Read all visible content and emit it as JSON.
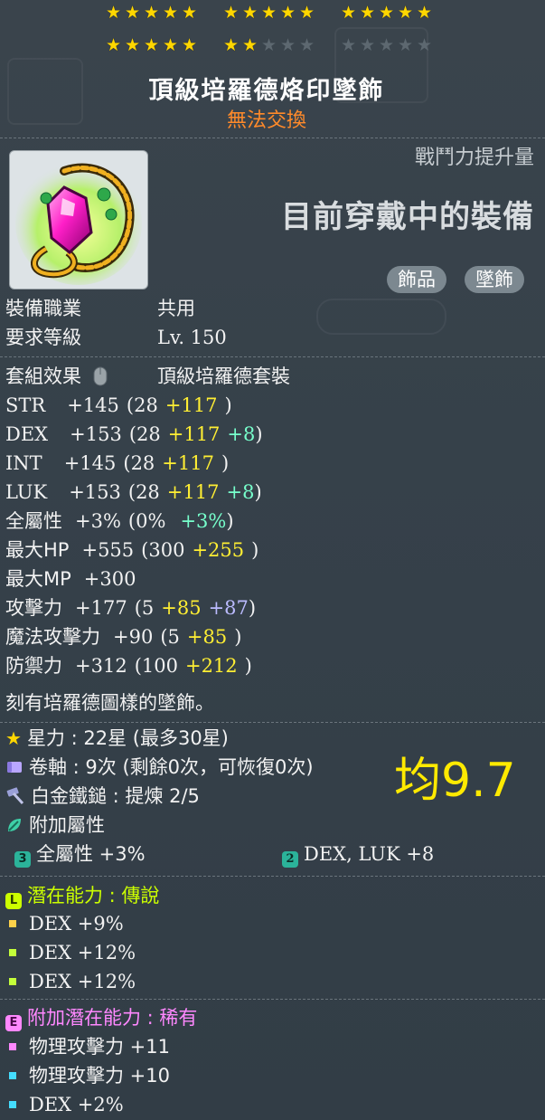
{
  "stars": {
    "filled": 22,
    "max": 30
  },
  "item": {
    "name": "頂級培羅德烙印墜飾",
    "tradability": "無法交換",
    "combat_power_label": "戰鬥力提升量",
    "combat_power_value": "目前穿戴中的裝備",
    "tags": [
      "飾品",
      "墜飾"
    ]
  },
  "requirements": {
    "job_label": "裝備職業",
    "job_value": "共用",
    "level_label": "要求等級",
    "level_value": "Lv. 150"
  },
  "set": {
    "label": "套組效果",
    "value": "頂級培羅德套裝"
  },
  "stats": [
    {
      "name": "STR",
      "total": "+145",
      "base": "(28",
      "scroll": "+117",
      "flame": "",
      "close": ")"
    },
    {
      "name": "DEX",
      "total": "+153",
      "base": "(28",
      "scroll": "+117",
      "flame": "+8",
      "close": ")"
    },
    {
      "name": "INT",
      "total": "+145",
      "base": "(28",
      "scroll": "+117",
      "flame": "",
      "close": ")"
    },
    {
      "name": "LUK",
      "total": "+153",
      "base": "(28",
      "scroll": "+117",
      "flame": "+8",
      "close": ")"
    },
    {
      "name": "全屬性",
      "total": "+3%",
      "base": "(0%",
      "scroll": "",
      "flame": "+3%",
      "close": ")"
    },
    {
      "name": "最大HP",
      "total": "+555",
      "base": "(300",
      "scroll": "+255",
      "flame": "",
      "close": ")"
    },
    {
      "name": "最大MP",
      "total": "+300",
      "base": "",
      "scroll": "",
      "flame": "",
      "close": ""
    },
    {
      "name": "攻擊力",
      "total": "+177",
      "base": "(5",
      "scroll": "+85",
      "flame": "+87",
      "close": ")"
    },
    {
      "name": "魔法攻擊力",
      "total": "+90",
      "base": "(5",
      "scroll": "+85",
      "flame": "",
      "close": ")"
    },
    {
      "name": "防禦力",
      "total": "+312",
      "base": "(100",
      "scroll": "+212",
      "flame": "",
      "close": ")"
    }
  ],
  "description": "刻有培羅德圖樣的墜飾。",
  "upgrades": {
    "starforce": "星力 : 22星 (最多30星)",
    "scrolls": "卷軸 : 9次 (剩餘0次，可恢復0次)",
    "hammer": "白金鐵鎚 : 提煉 2/5",
    "bonus_label": "附加屬性",
    "bonus_1_icon": "3",
    "bonus_1": "全屬性 +3%",
    "bonus_2_icon": "2",
    "bonus_2": "DEX, LUK  +8"
  },
  "score": "均9.7",
  "potential": {
    "icon": "L",
    "title": "潛在能力 : 傳說",
    "lines": [
      "DEX +9%",
      "DEX +12%",
      "DEX +12%"
    ]
  },
  "bonus_potential": {
    "icon": "E",
    "title": "附加潛在能力 : 稀有",
    "lines": [
      "物理攻擊力 +11",
      "物理攻擊力 +10",
      "DEX +2%"
    ]
  },
  "colors": {
    "star_on": "#ffd700",
    "tradability": "#ff8a2a",
    "scroll_bonus": "#ffee33",
    "flame_bonus": "#77ffcc",
    "legendary": "#ccff00",
    "rare": "#ff88ff",
    "score": "#ffea00"
  }
}
